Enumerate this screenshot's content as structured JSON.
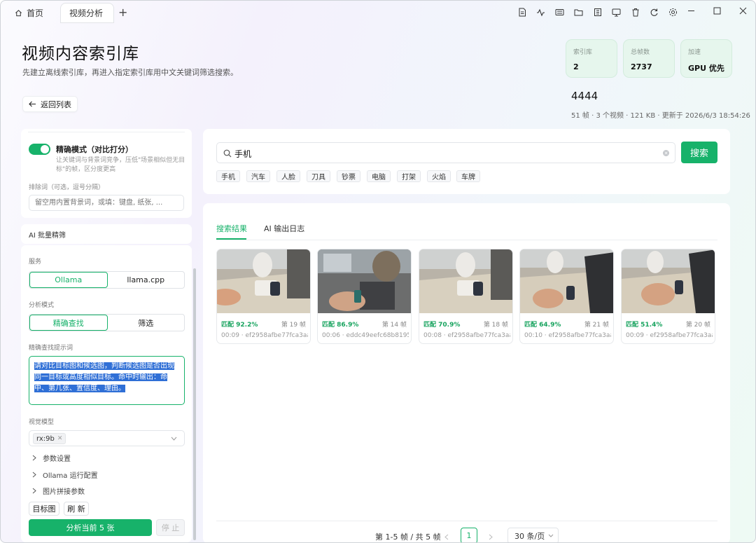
{
  "titlebar": {
    "tabs": [
      {
        "label": "首页",
        "icon": "home-icon"
      },
      {
        "label": "视频分析"
      }
    ],
    "new_tab": "+"
  },
  "header": {
    "title": "视频内容索引库",
    "subtitle": "先建立离线索引库，再进入指定索引库用中文关键词筛选搜索。",
    "back_label": "返回列表"
  },
  "stats": [
    {
      "label": "索引库",
      "value": "2"
    },
    {
      "label": "总帧数",
      "value": "2737"
    },
    {
      "label": "加速",
      "value": "GPU 优先"
    }
  ],
  "index": {
    "name": "4444",
    "meta": "51 帧 · 3 个视频 · 121 KB · 更新于 2026/6/3 18:54:26"
  },
  "left": {
    "precise_title": "精确模式（对比打分）",
    "precise_desc": "让关键词与背景词竞争，压低\"场景相似但无目标\"的帧，区分度更高",
    "exclude_label": "排除词（可选，逗号分隔）",
    "exclude_placeholder": "留空用内置背景词，或填：键盘, 纸张, ...",
    "ai_title": "AI 批量精筛",
    "service_label": "服务",
    "services": [
      "Ollama",
      "llama.cpp"
    ],
    "mode_label": "分析模式",
    "modes": [
      "精确查找",
      "筛选"
    ],
    "prompt_label": "精确查找提示词",
    "prompt_text": "请对比目标图和候选图，判断候选图是否出现同一目标或高度相似目标。命中时输出：命中、第几张、置信度、理由。",
    "model_label": "视觉模型",
    "model_tag": "rx:9b",
    "accordions": [
      "参数设置",
      "Ollama 运行配置",
      "图片拼接参数"
    ],
    "target_btn": "目标图",
    "refresh_btn": "刷 新",
    "analyze_btn": "分析当前 5 张",
    "stop_btn": "停 止"
  },
  "search": {
    "value": "手机",
    "button": "搜索",
    "chips": [
      "手机",
      "汽车",
      "人脸",
      "刀具",
      "钞票",
      "电脑",
      "打架",
      "火焰",
      "车牌"
    ]
  },
  "results": {
    "tabs": [
      "搜索结果",
      "AI 输出日志"
    ],
    "items": [
      {
        "match": "匹配 92.2%",
        "frame": "第 19 帧",
        "meta": "00:09 · ef2958afbe77fca3aa..."
      },
      {
        "match": "匹配 86.9%",
        "frame": "第 14 帧",
        "meta": "00:06 · eddc49eefc68b8195..."
      },
      {
        "match": "匹配 70.9%",
        "frame": "第 18 帧",
        "meta": "00:08 · ef2958afbe77fca3aa..."
      },
      {
        "match": "匹配 64.9%",
        "frame": "第 21 帧",
        "meta": "00:10 · ef2958afbe77fca3aa..."
      },
      {
        "match": "匹配 51.4%",
        "frame": "第 20 帧",
        "meta": "00:09 · ef2958afbe77fca3aa..."
      }
    ]
  },
  "pagination": {
    "summary": "第 1-5 帧 / 共 5 帧",
    "current": "1",
    "page_size": "30 条/页"
  },
  "colors": {
    "accent": "#17b26a",
    "selection": "#2f6fd6"
  }
}
